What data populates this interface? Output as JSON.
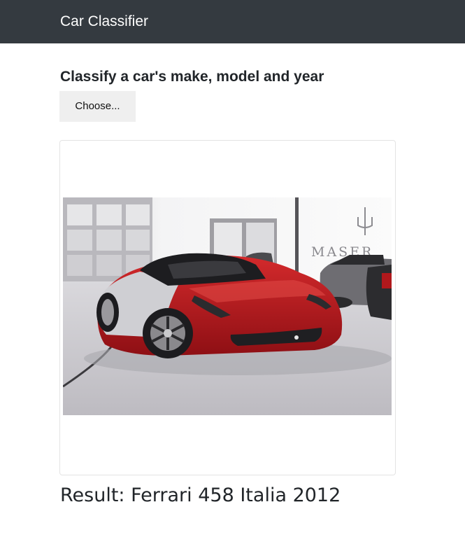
{
  "navbar": {
    "brand": "Car Classifier"
  },
  "main": {
    "heading": "Classify a car's make, model and year",
    "choose_button_label": "Choose...",
    "image": {
      "description_icon": "car-photo",
      "showroom_sign_text": "MASER"
    },
    "result_label": "Result:",
    "result_value": "Ferrari 458 Italia 2012",
    "result_text": "Result: Ferrari 458 Italia 2012"
  },
  "colors": {
    "navbar_bg": "#343a40",
    "navbar_text": "#ffffff",
    "car_red": "#b3151b"
  }
}
